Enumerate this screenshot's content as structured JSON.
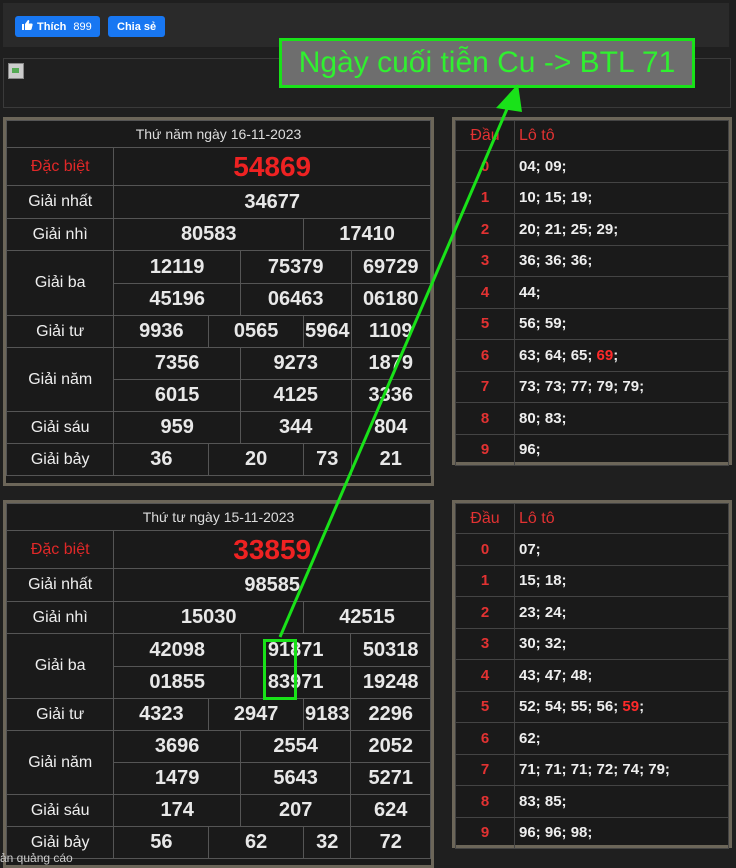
{
  "social": {
    "like_label": "Thích",
    "like_count": "899",
    "share_label": "Chia sẻ"
  },
  "headline": "Ngày cuối tiễn Cu -> BTL 71",
  "colors": {
    "arrow": "#19e219",
    "special": "#ee2222",
    "panel_border": "#6c6659"
  },
  "ad_label": "ản quảng cáo",
  "day1": {
    "title": "Thứ năm ngày 16-11-2023",
    "labels": {
      "db": "Đặc biệt",
      "g1": "Giải nhất",
      "g2": "Giải nhì",
      "g3": "Giải ba",
      "g4": "Giải tư",
      "g5": "Giải năm",
      "g6": "Giải sáu",
      "g7": "Giải bảy"
    },
    "db": "54869",
    "g1": "34677",
    "g2": [
      "80583",
      "17410"
    ],
    "g3": [
      "12119",
      "75379",
      "69729",
      "45196",
      "06463",
      "06180"
    ],
    "g4": [
      "9936",
      "0565",
      "5964",
      "1109"
    ],
    "g5": [
      "7356",
      "9273",
      "1879",
      "6015",
      "4125",
      "3336"
    ],
    "g6": [
      "959",
      "344",
      "804"
    ],
    "g7": [
      "36",
      "20",
      "73",
      "21"
    ]
  },
  "loto1": {
    "head_dau": "Đầu",
    "head_loto": "Lô tô",
    "rows": [
      {
        "dau": "0",
        "val": "04; 09;"
      },
      {
        "dau": "1",
        "val": "10; 15; 19;"
      },
      {
        "dau": "2",
        "val": "20; 21; 25; 29;"
      },
      {
        "dau": "3",
        "val": "36; 36; 36;"
      },
      {
        "dau": "4",
        "val": "44;"
      },
      {
        "dau": "5",
        "val": "56; 59;"
      },
      {
        "dau": "6",
        "val": "63; 64; 65;",
        "hl": "69",
        "tail": ";"
      },
      {
        "dau": "7",
        "val": "73; 73; 77; 79; 79;"
      },
      {
        "dau": "8",
        "val": "80; 83;"
      },
      {
        "dau": "9",
        "val": "96;"
      }
    ]
  },
  "day2": {
    "title": "Thứ tư ngày 15-11-2023",
    "labels": {
      "db": "Đặc biệt",
      "g1": "Giải nhất",
      "g2": "Giải nhì",
      "g3": "Giải ba",
      "g4": "Giải tư",
      "g5": "Giải năm",
      "g6": "Giải sáu",
      "g7": "Giải bảy"
    },
    "db": "33859",
    "g1": "98585",
    "g2": [
      "15030",
      "42515"
    ],
    "g3": [
      "42098",
      "91871",
      "50318",
      "01855",
      "83971",
      "19248"
    ],
    "g4": [
      "4323",
      "2947",
      "9183",
      "2296"
    ],
    "g5": [
      "3696",
      "2554",
      "2052",
      "1479",
      "5643",
      "5271"
    ],
    "g6": [
      "174",
      "207",
      "624"
    ],
    "g7": [
      "56",
      "62",
      "32",
      "72"
    ]
  },
  "loto2": {
    "head_dau": "Đầu",
    "head_loto": "Lô tô",
    "rows": [
      {
        "dau": "0",
        "val": "07;"
      },
      {
        "dau": "1",
        "val": "15; 18;"
      },
      {
        "dau": "2",
        "val": "23; 24;"
      },
      {
        "dau": "3",
        "val": "30; 32;"
      },
      {
        "dau": "4",
        "val": "43; 47; 48;"
      },
      {
        "dau": "5",
        "val": "52; 54; 55; 56;",
        "hl": "59",
        "tail": ";"
      },
      {
        "dau": "6",
        "val": "62;"
      },
      {
        "dau": "7",
        "val": "71; 71; 71; 72; 74; 79;"
      },
      {
        "dau": "8",
        "val": "83; 85;"
      },
      {
        "dau": "9",
        "val": "96; 96; 98;"
      }
    ]
  }
}
